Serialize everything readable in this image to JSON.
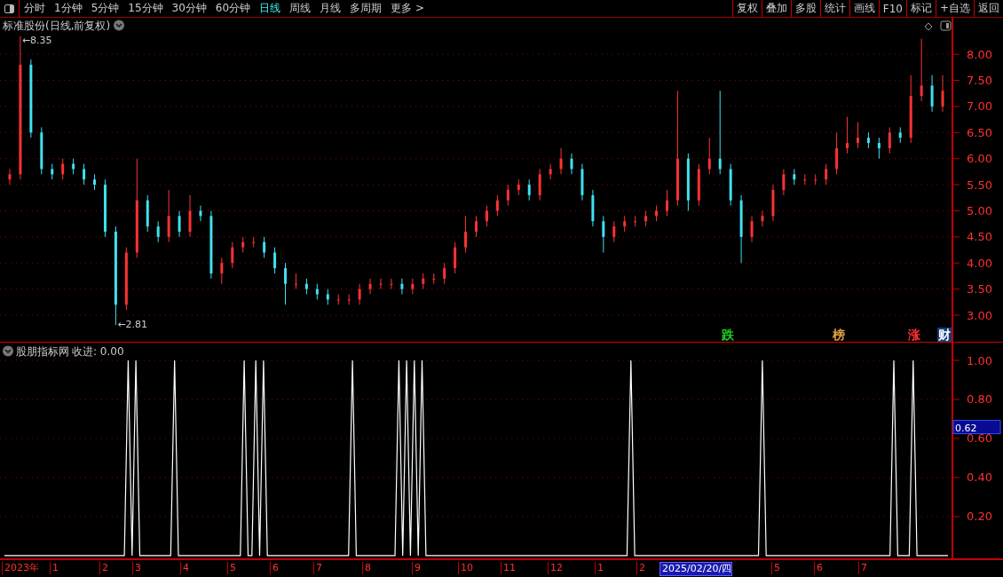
{
  "toolbar": {
    "periods": [
      {
        "label": "分时",
        "selected": false
      },
      {
        "label": "1分钟",
        "selected": false
      },
      {
        "label": "5分钟",
        "selected": false
      },
      {
        "label": "15分钟",
        "selected": false
      },
      {
        "label": "30分钟",
        "selected": false
      },
      {
        "label": "60分钟",
        "selected": false
      },
      {
        "label": "日线",
        "selected": true
      },
      {
        "label": "周线",
        "selected": false
      },
      {
        "label": "月线",
        "selected": false
      },
      {
        "label": "多周期",
        "selected": false
      },
      {
        "label": "更多 >",
        "selected": false
      }
    ],
    "buttons": [
      "复权",
      "叠加",
      "多股",
      "统计",
      "画线",
      "F10",
      "标记",
      "+自选",
      "返回"
    ]
  },
  "price_panel": {
    "title": "标准股份(日线,前复权)",
    "chart_data": {
      "type": "candlestick",
      "grid": true,
      "yticks": [
        {
          "value": 3,
          "label": "3.00"
        },
        {
          "value": 3.5,
          "label": "3.50"
        },
        {
          "value": 4,
          "label": "4.00"
        },
        {
          "value": 4.5,
          "label": "4.50"
        },
        {
          "value": 5,
          "label": "5.00"
        },
        {
          "value": 5.5,
          "label": "5.50"
        },
        {
          "value": 6,
          "label": "6.00"
        },
        {
          "value": 6.5,
          "label": "6.50"
        },
        {
          "value": 7,
          "label": "7.00"
        },
        {
          "value": 7.5,
          "label": "7.50"
        },
        {
          "value": 8,
          "label": "8.00"
        }
      ],
      "ylim": [
        2.49,
        8.7
      ],
      "ohlc": [
        [
          5.6,
          5.8,
          5.5,
          5.7
        ],
        [
          5.7,
          8.35,
          5.6,
          7.8
        ],
        [
          7.8,
          7.9,
          6.4,
          6.5
        ],
        [
          6.5,
          6.6,
          5.7,
          5.8
        ],
        [
          5.8,
          5.9,
          5.6,
          5.7
        ],
        [
          5.7,
          6.0,
          5.6,
          5.9
        ],
        [
          5.9,
          6.0,
          5.7,
          5.8
        ],
        [
          5.8,
          5.9,
          5.5,
          5.6
        ],
        [
          5.6,
          5.7,
          5.4,
          5.5
        ],
        [
          5.5,
          5.6,
          4.5,
          4.6
        ],
        [
          4.6,
          4.7,
          2.81,
          3.2
        ],
        [
          3.2,
          4.3,
          3.1,
          4.2
        ],
        [
          4.2,
          6.0,
          4.1,
          5.2
        ],
        [
          5.2,
          5.3,
          4.6,
          4.7
        ],
        [
          4.7,
          4.8,
          4.4,
          4.5
        ],
        [
          4.5,
          5.4,
          4.4,
          4.9
        ],
        [
          4.9,
          5.0,
          4.5,
          4.6
        ],
        [
          4.6,
          5.3,
          4.5,
          5.0
        ],
        [
          5.0,
          5.1,
          4.8,
          4.9
        ],
        [
          4.9,
          5.0,
          3.7,
          3.8
        ],
        [
          3.8,
          4.1,
          3.6,
          4.0
        ],
        [
          4.0,
          4.4,
          3.9,
          4.3
        ],
        [
          4.3,
          4.5,
          4.2,
          4.4
        ],
        [
          4.4,
          4.5,
          4.3,
          4.4
        ],
        [
          4.4,
          4.5,
          4.1,
          4.2
        ],
        [
          4.2,
          4.3,
          3.8,
          3.9
        ],
        [
          3.9,
          4.0,
          3.2,
          3.6
        ],
        [
          3.6,
          3.8,
          3.5,
          3.6
        ],
        [
          3.6,
          3.7,
          3.4,
          3.5
        ],
        [
          3.5,
          3.6,
          3.3,
          3.4
        ],
        [
          3.4,
          3.5,
          3.2,
          3.3
        ],
        [
          3.3,
          3.4,
          3.2,
          3.3
        ],
        [
          3.3,
          3.4,
          3.2,
          3.3
        ],
        [
          3.3,
          3.6,
          3.2,
          3.5
        ],
        [
          3.5,
          3.7,
          3.4,
          3.6
        ],
        [
          3.6,
          3.7,
          3.5,
          3.6
        ],
        [
          3.6,
          3.7,
          3.5,
          3.6
        ],
        [
          3.6,
          3.7,
          3.4,
          3.5
        ],
        [
          3.5,
          3.7,
          3.4,
          3.6
        ],
        [
          3.6,
          3.8,
          3.5,
          3.7
        ],
        [
          3.7,
          3.8,
          3.6,
          3.7
        ],
        [
          3.7,
          4.0,
          3.6,
          3.9
        ],
        [
          3.9,
          4.4,
          3.8,
          4.3
        ],
        [
          4.3,
          4.9,
          4.2,
          4.6
        ],
        [
          4.6,
          4.9,
          4.5,
          4.8
        ],
        [
          4.8,
          5.1,
          4.7,
          5.0
        ],
        [
          5.0,
          5.3,
          4.9,
          5.2
        ],
        [
          5.2,
          5.5,
          5.1,
          5.4
        ],
        [
          5.4,
          5.6,
          5.3,
          5.5
        ],
        [
          5.5,
          5.6,
          5.2,
          5.3
        ],
        [
          5.3,
          5.8,
          5.2,
          5.7
        ],
        [
          5.7,
          5.9,
          5.6,
          5.8
        ],
        [
          5.8,
          6.2,
          5.7,
          6.0
        ],
        [
          6.0,
          6.1,
          5.7,
          5.8
        ],
        [
          5.8,
          5.9,
          5.2,
          5.3
        ],
        [
          5.3,
          5.4,
          4.7,
          4.8
        ],
        [
          4.8,
          4.9,
          4.2,
          4.5
        ],
        [
          4.5,
          4.8,
          4.4,
          4.7
        ],
        [
          4.7,
          4.9,
          4.6,
          4.8
        ],
        [
          4.8,
          4.9,
          4.7,
          4.8
        ],
        [
          4.8,
          5.0,
          4.7,
          4.9
        ],
        [
          4.9,
          5.1,
          4.8,
          5.0
        ],
        [
          5.0,
          5.4,
          4.9,
          5.2
        ],
        [
          5.2,
          7.3,
          5.1,
          6.0
        ],
        [
          6.0,
          6.1,
          5.0,
          5.2
        ],
        [
          5.2,
          5.9,
          5.1,
          5.8
        ],
        [
          5.8,
          6.4,
          5.7,
          6.0
        ],
        [
          6.0,
          7.3,
          5.7,
          5.8
        ],
        [
          5.8,
          5.9,
          5.1,
          5.2
        ],
        [
          5.2,
          5.3,
          4.0,
          4.5
        ],
        [
          4.5,
          4.9,
          4.4,
          4.8
        ],
        [
          4.8,
          5.0,
          4.7,
          4.9
        ],
        [
          4.9,
          5.5,
          4.8,
          5.4
        ],
        [
          5.4,
          5.8,
          5.3,
          5.7
        ],
        [
          5.7,
          5.8,
          5.5,
          5.6
        ],
        [
          5.6,
          5.7,
          5.5,
          5.6
        ],
        [
          5.6,
          5.7,
          5.5,
          5.6
        ],
        [
          5.6,
          5.9,
          5.5,
          5.8
        ],
        [
          5.8,
          6.5,
          5.7,
          6.2
        ],
        [
          6.2,
          6.8,
          6.1,
          6.3
        ],
        [
          6.3,
          6.7,
          6.2,
          6.4
        ],
        [
          6.4,
          6.5,
          6.2,
          6.3
        ],
        [
          6.3,
          6.4,
          6.0,
          6.2
        ],
        [
          6.2,
          6.6,
          6.1,
          6.5
        ],
        [
          6.5,
          6.6,
          6.3,
          6.4
        ],
        [
          6.4,
          7.6,
          6.3,
          7.2
        ],
        [
          7.2,
          8.3,
          7.1,
          7.4
        ],
        [
          7.4,
          7.6,
          6.9,
          7.0
        ],
        [
          7.0,
          7.6,
          6.9,
          7.3
        ]
      ],
      "annotations": [
        "←8.35",
        "←2.81"
      ]
    },
    "signals": [
      {
        "label": "跌",
        "kind": "text",
        "color": "#20d020"
      },
      {
        "label": "榜",
        "kind": "text",
        "color": "#e0a040"
      },
      {
        "label": "涨",
        "kind": "text",
        "color": "#ff3030"
      },
      {
        "label": "财",
        "kind": "badge",
        "color": "#103a7a"
      }
    ]
  },
  "indicator_panel": {
    "title": "股朋指标网",
    "reading": "收进: 0.00",
    "cursor_value": "0.62",
    "chart_data": {
      "type": "line",
      "grid": true,
      "yticks": [
        {
          "value": 0.2,
          "label": "0.20"
        },
        {
          "value": 0.4,
          "label": "0.40"
        },
        {
          "value": 0.6,
          "label": "0.60"
        },
        {
          "value": 0.8,
          "label": "0.80"
        },
        {
          "value": 1,
          "label": "1.00"
        }
      ],
      "ylim": [
        -0.014,
        1.091
      ],
      "series": [
        {
          "color": "#ffffff",
          "values": [
            0,
            0,
            0,
            0,
            0,
            0,
            0,
            0,
            0,
            0,
            0,
            0,
            0,
            0,
            0,
            0,
            0,
            0,
            0,
            0,
            0,
            0,
            0,
            0,
            0,
            0,
            0,
            0,
            0,
            0,
            0,
            0,
            1,
            0,
            1,
            0,
            0,
            0,
            0,
            0,
            0,
            0,
            0,
            0,
            1,
            0,
            0,
            0,
            0,
            0,
            0,
            0,
            0,
            0,
            0,
            0,
            0,
            0,
            0,
            0,
            0,
            0,
            1,
            0,
            0,
            1,
            0,
            1,
            0,
            0,
            0,
            0,
            0,
            0,
            0,
            0,
            0,
            0,
            0,
            0,
            0,
            0,
            0,
            0,
            0,
            0,
            0,
            0,
            0,
            0,
            1,
            0,
            0,
            0,
            0,
            0,
            0,
            0,
            0,
            0,
            0,
            0,
            1,
            0,
            1,
            0,
            1,
            0,
            1,
            0,
            0,
            0,
            0,
            0,
            0,
            0,
            0,
            0,
            0,
            0,
            0,
            0,
            0,
            0,
            0,
            0,
            0,
            0,
            0,
            0,
            0,
            0,
            0,
            0,
            0,
            0,
            0,
            0,
            0,
            0,
            0,
            0,
            0,
            0,
            0,
            0,
            0,
            0,
            0,
            0,
            0,
            0,
            0,
            0,
            0,
            0,
            0,
            0,
            0,
            0,
            0,
            0,
            1,
            0,
            0,
            0,
            0,
            0,
            0,
            0,
            0,
            0,
            0,
            0,
            0,
            0,
            0,
            0,
            0,
            0,
            0,
            0,
            0,
            0,
            0,
            0,
            0,
            0,
            0,
            0,
            0,
            0,
            0,
            0,
            0,
            0,
            1,
            0,
            0,
            0,
            0,
            0,
            0,
            0,
            0,
            0,
            0,
            0,
            0,
            0,
            0,
            0,
            0,
            0,
            0,
            0,
            0,
            0,
            0,
            0,
            0,
            0,
            0,
            0,
            0,
            0,
            0,
            0,
            0,
            0,
            1,
            0,
            0,
            0,
            0,
            1,
            0,
            0,
            0,
            0,
            0,
            0,
            0,
            0,
            0
          ]
        }
      ]
    }
  },
  "date_axis": [
    {
      "label": "2023年",
      "selected": false
    },
    {
      "label": "1",
      "selected": false
    },
    {
      "label": "2",
      "selected": false
    },
    {
      "label": "3",
      "selected": false
    },
    {
      "label": "4",
      "selected": false
    },
    {
      "label": "5",
      "selected": false
    },
    {
      "label": "6",
      "selected": false
    },
    {
      "label": "7",
      "selected": false
    },
    {
      "label": "8",
      "selected": false
    },
    {
      "label": "9",
      "selected": false
    },
    {
      "label": "10",
      "selected": false
    },
    {
      "label": "11",
      "selected": false
    },
    {
      "label": "12",
      "selected": false
    },
    {
      "label": "1",
      "selected": false
    },
    {
      "label": "2",
      "selected": false
    },
    {
      "label": "2025/02/20/四",
      "selected": true
    },
    {
      "label": "5",
      "selected": false
    },
    {
      "label": "6",
      "selected": false
    },
    {
      "label": "7",
      "selected": false
    }
  ]
}
